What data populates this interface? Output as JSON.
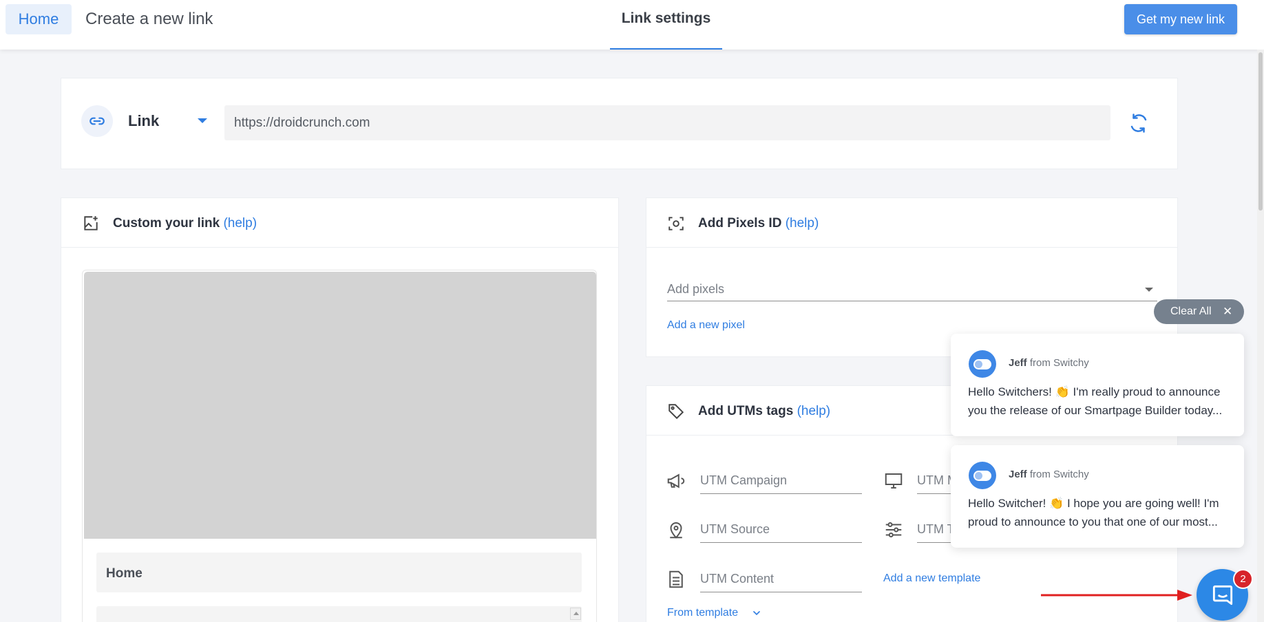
{
  "topbar": {
    "home_label": "Home",
    "create_title": "Create a new link",
    "active_tab": "Link settings",
    "cta_label": "Get my new link"
  },
  "link_card": {
    "type_label": "Link",
    "url_value": "https://droidcrunch.com"
  },
  "custom_card": {
    "title": "Custom your link",
    "help": "(help)",
    "preview_title_value": "Home"
  },
  "pixels_card": {
    "title": "Add Pixels ID",
    "help": "(help)",
    "select_placeholder": "Add pixels",
    "add_link": "Add a new pixel"
  },
  "utm_card": {
    "title": "Add UTMs tags",
    "help": "(help)",
    "fields": {
      "campaign": "UTM Campaign",
      "medium": "UTM M",
      "source": "UTM Source",
      "term": "UTM T",
      "content": "UTM Content"
    },
    "add_template": "Add a new template",
    "from_template": "From template"
  },
  "notifications": {
    "clear_all": "Clear All",
    "items": [
      {
        "sender_name": "Jeff",
        "sender_suffix": "from Switchy",
        "line1": "Hello Switchers! 👏 I'm really proud to announce",
        "line2": "you the release of our Smartpage Builder today..."
      },
      {
        "sender_name": "Jeff",
        "sender_suffix": "from Switchy",
        "line1": "Hello Switcher! 👏 I hope you are going well! I'm",
        "line2": "proud to announce to you that one of our most..."
      }
    ]
  },
  "messenger": {
    "badge_count": "2"
  },
  "colors": {
    "accent": "#2f7de1",
    "cta": "#4a8ee8",
    "badge": "#d7242a",
    "annotation_arrow": "#e02020"
  }
}
